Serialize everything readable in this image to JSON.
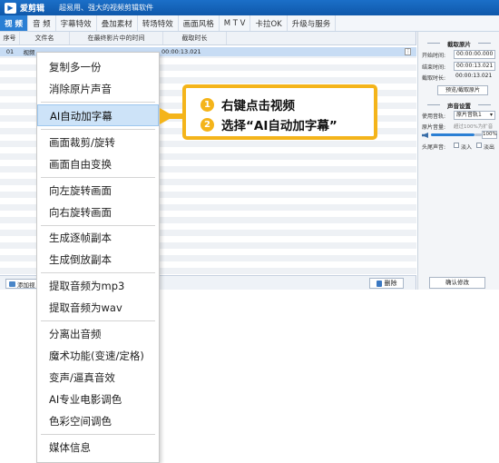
{
  "window": {
    "app_name": "爱剪辑",
    "slogan": "超易用、强大的视频剪辑软件"
  },
  "tabs": [
    "视 频",
    "音 频",
    "字幕特效",
    "叠加素材",
    "转场特效",
    "画面风格",
    "M T V",
    "卡拉OK",
    "升级与服务"
  ],
  "table": {
    "headers": [
      "序号",
      "文件名",
      "在最终影片中的时间",
      "截取时长"
    ],
    "selected_row": {
      "index": "01",
      "name": "视频",
      "time": "00:00:13.021"
    },
    "row_button": "⋮"
  },
  "bottom": {
    "add_label": "添加视",
    "delete_label": "删除"
  },
  "right_panel": {
    "clip_title": "截取原片",
    "start_label": "开始时间:",
    "start_value": "00:00:00.000",
    "end_label": "结束时间:",
    "end_value": "00:00:13.021",
    "duration_label": "截取时长:",
    "duration_value": "00:00:13.021",
    "preview_btn": "预览/截取原片",
    "sound_title": "声音设置",
    "track_label": "使用音轨:",
    "track_value": "原片音轨1",
    "volume_label": "原片音量:",
    "volume_hint": "超过100%为扩音",
    "volume_pct": "100%",
    "volume_level": 0.85,
    "fade_label": "头尾声音:",
    "fade_in": "淡入",
    "fade_out": "淡出",
    "confirm_btn": "确认修改"
  },
  "context_menu": {
    "items": [
      "复制多一份",
      "消除原片声音",
      "AI自动加字幕",
      "画面裁剪/旋转",
      "画面自由变换",
      "向左旋转画面",
      "向右旋转画面",
      "生成逐帧副本",
      "生成倒放副本",
      "提取音频为mp3",
      "提取音频为wav",
      "分离出音频",
      "魔术功能(变速/定格)",
      "变声/逼真音效",
      "AI专业电影调色",
      "色彩空间调色",
      "媒体信息"
    ]
  },
  "callout": {
    "step1_num": "1",
    "step1_text": "右键点击视频",
    "step2_num": "2",
    "step2_text": "选择“AI自动加字幕”"
  },
  "colors": {
    "titlebar": "#1565c0",
    "accent": "#2a7fd4",
    "callout": "#f4b41a",
    "highlight": "#cde3f8"
  }
}
